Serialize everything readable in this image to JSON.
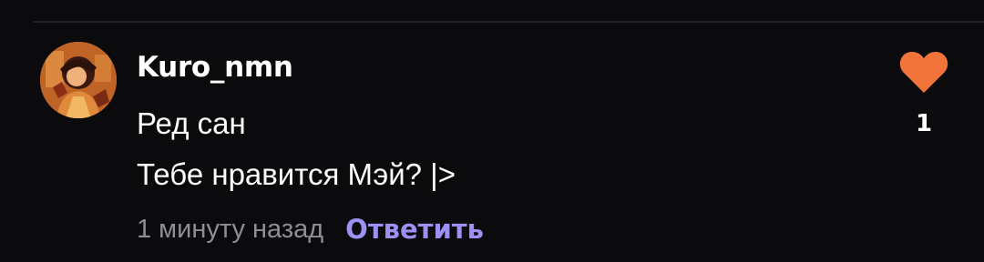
{
  "comment": {
    "author": "Kuro_nmn",
    "avatar_icon": "user-avatar",
    "lines": [
      "Ред сан",
      "Тебе нравится Мэй? |>"
    ],
    "timestamp": "1 минуту назад",
    "reply_label": "Ответить",
    "likes": {
      "icon": "heart-icon",
      "count": "1",
      "color": "#f2743a"
    },
    "reply_color": "#9d90f3"
  }
}
